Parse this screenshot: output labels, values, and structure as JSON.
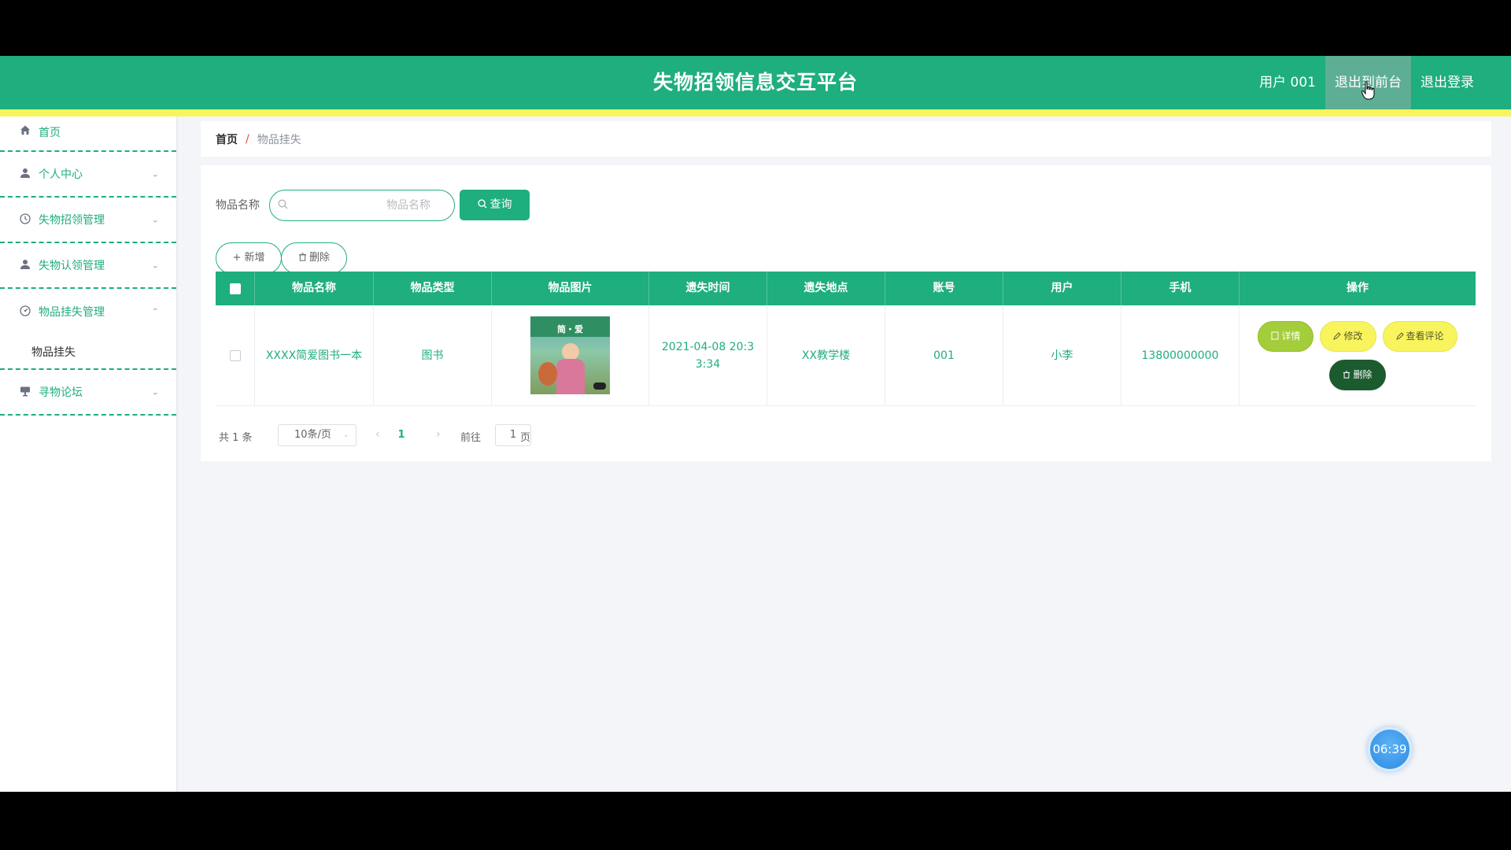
{
  "header": {
    "title": "失物招领信息交互平台",
    "user": "用户 001",
    "to_front": "退出到前台",
    "logout": "退出登录"
  },
  "sidebar": {
    "items": [
      {
        "label": "首页",
        "icon": "home-icon"
      },
      {
        "label": "个人中心",
        "icon": "user-icon"
      },
      {
        "label": "失物招领管理",
        "icon": "clock-icon"
      },
      {
        "label": "失物认领管理",
        "icon": "user-icon"
      },
      {
        "label": "物品挂失管理",
        "icon": "gauge-icon"
      },
      {
        "label": "寻物论坛",
        "icon": "forum-icon"
      }
    ],
    "sub_item": "物品挂失"
  },
  "breadcrumb": {
    "home": "首页",
    "separator": "/",
    "current": "物品挂失"
  },
  "search": {
    "label": "物品名称",
    "placeholder": "物品名称",
    "query_label": "查询"
  },
  "actions": {
    "add": "+ 新增",
    "delete": "删除"
  },
  "table": {
    "columns": [
      "物品名称",
      "物品类型",
      "物品图片",
      "遗失时间",
      "遗失地点",
      "账号",
      "用户",
      "手机",
      "操作"
    ],
    "rows": [
      {
        "name": "XXXX简爱图书一本",
        "type": "图书",
        "image_text": "简・爱",
        "time": "2021-04-08 20:33:34",
        "place": "XX教学楼",
        "account": "001",
        "user": "小李",
        "phone": "13800000000",
        "ops": {
          "detail": "详情",
          "edit": "修改",
          "comment": "查看评论",
          "delete": "删除"
        }
      }
    ]
  },
  "pagination": {
    "total": "共 1 条",
    "page_size": "10条/页",
    "current_page": "1",
    "goto_label": "前往",
    "goto_value": "1",
    "page_suffix": "页"
  },
  "timer": "06:39",
  "colors": {
    "primary": "#1fae7e",
    "accent_yellow": "#f7f45d",
    "detail_green": "#a3cd3a",
    "dark_green": "#1b5b2e"
  }
}
